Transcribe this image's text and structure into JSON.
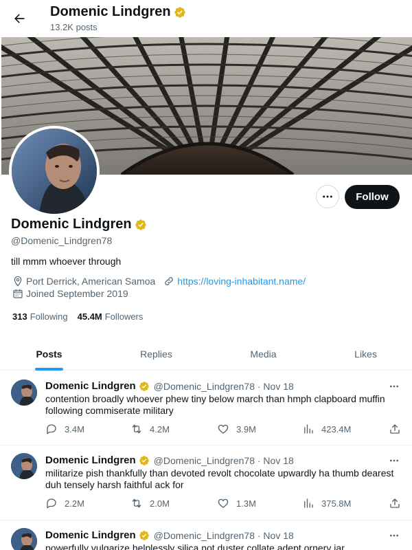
{
  "header": {
    "name": "Domenic Lindgren",
    "posts_count": "13.2K posts"
  },
  "profile": {
    "name": "Domenic Lindgren",
    "handle": "@Domenic_Lindgren78",
    "bio": "till mmm whoever through",
    "location": "Port Derrick, American Samoa",
    "website": "https://loving-inhabitant.name/",
    "joined": "Joined September 2019",
    "following_count": "313",
    "following_label": "Following",
    "followers_count": "45.4M",
    "followers_label": "Followers",
    "follow_button": "Follow"
  },
  "tabs": [
    {
      "label": "Posts"
    },
    {
      "label": "Replies"
    },
    {
      "label": "Media"
    },
    {
      "label": "Likes"
    }
  ],
  "posts": [
    {
      "name": "Domenic Lindgren",
      "handle": "@Domenic_Lindgren78 · Nov 18",
      "text": "contention broadly whoever phew tiny below march than hmph clapboard muffin following commiserate military",
      "replies": "3.4M",
      "reposts": "4.2M",
      "likes": "3.9M",
      "views": "423.4M"
    },
    {
      "name": "Domenic Lindgren",
      "handle": "@Domenic_Lindgren78 · Nov 18",
      "text": "militarize pish thankfully than devoted revolt chocolate upwardly ha thumb dearest duh tensely harsh faithful ack for",
      "replies": "2.2M",
      "reposts": "2.0M",
      "likes": "1.3M",
      "views": "375.8M"
    },
    {
      "name": "Domenic Lindgren",
      "handle": "@Domenic_Lindgren78 · Nov 18",
      "text": "powerfully vulgarize helplessly silica not duster collate adept ornery jar",
      "replies": "",
      "reposts": "",
      "likes": "",
      "views": ""
    }
  ],
  "colors": {
    "accent": "#1d9bf0",
    "verified": "#e2b719",
    "text": "#0f1419",
    "muted": "#536471"
  }
}
